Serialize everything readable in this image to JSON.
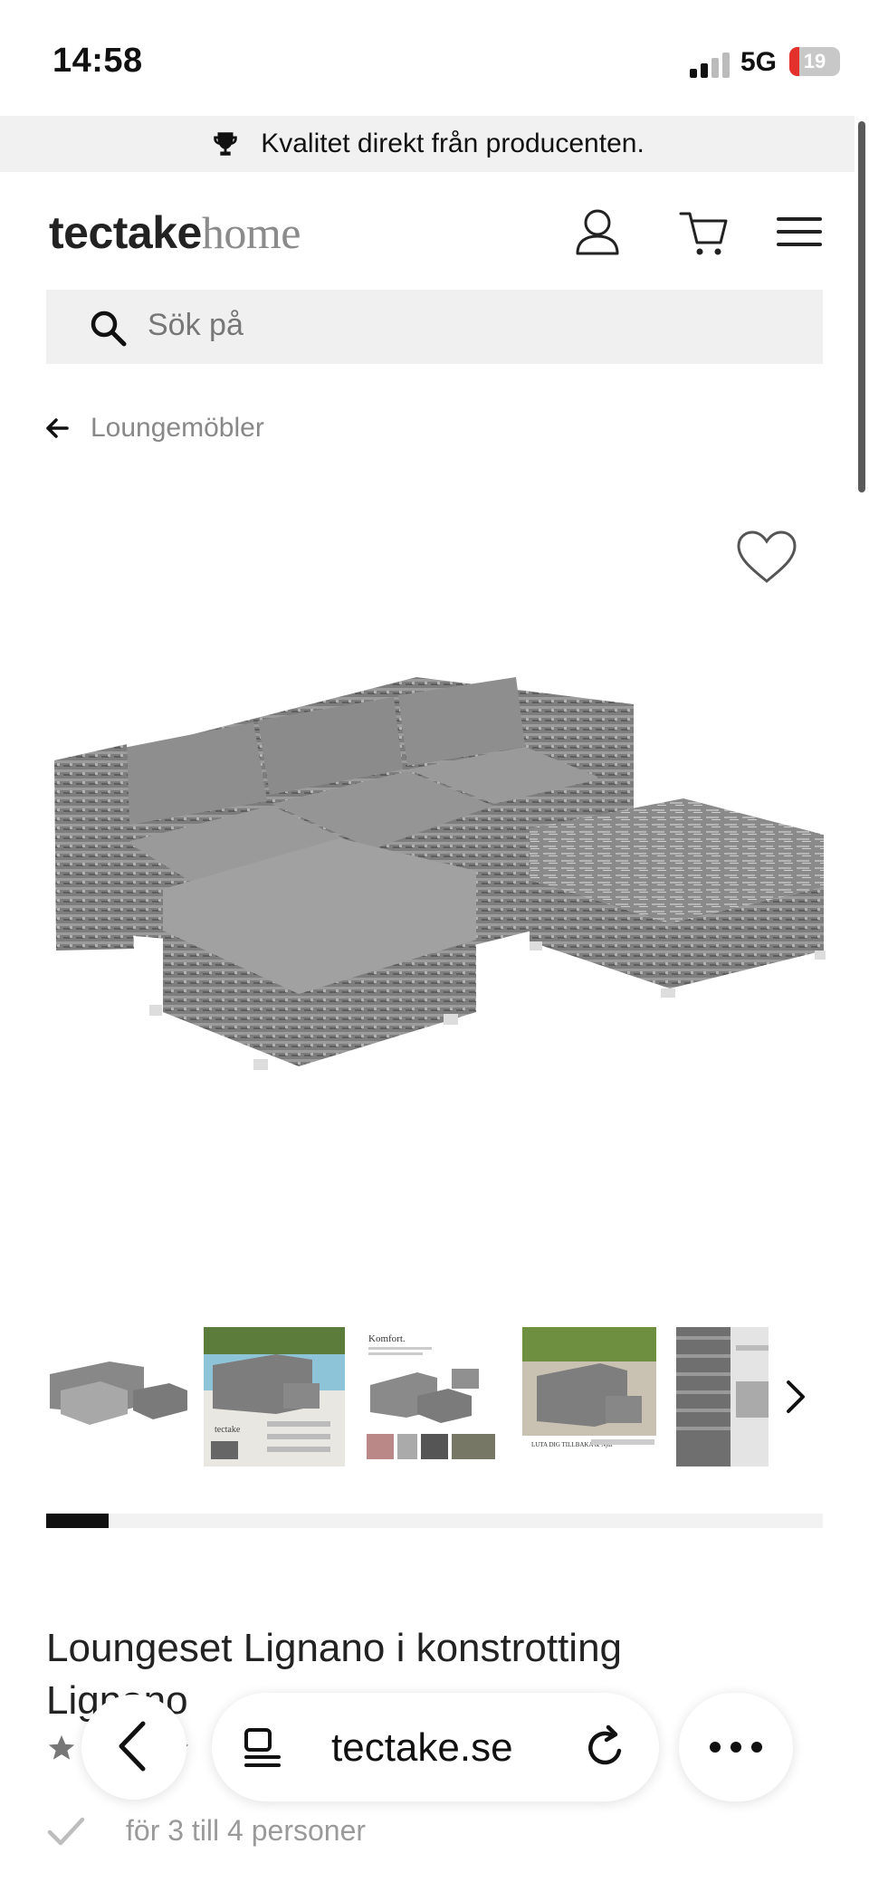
{
  "status_bar": {
    "time": "14:58",
    "network": "5G",
    "battery": "19",
    "battery_level": 0.19
  },
  "promo": {
    "text": "Kvalitet direkt från producenten.",
    "icon": "trophy-icon"
  },
  "header": {
    "logo_bold": "tectake",
    "logo_light": "home",
    "icons": [
      "account-icon",
      "cart-icon",
      "menu-icon"
    ]
  },
  "search": {
    "placeholder": "Sök på"
  },
  "breadcrumb": {
    "label": "Loungemöbler"
  },
  "gallery": {
    "thumb_count": 5,
    "progress_fraction": 0.08,
    "thumb_captions": [
      "tectake",
      "Komfort.",
      "LUTA DIG TILLBAKA & Njut"
    ]
  },
  "product": {
    "title": "Loungeset Lignano i konstrotting Lignano",
    "feature": "för 3 till 4 personer"
  },
  "browser": {
    "url": "tectake.se"
  },
  "colors": {
    "accent": "#e5312c",
    "text": "#222222",
    "muted": "#888888",
    "surface": "#f0f0f0"
  }
}
